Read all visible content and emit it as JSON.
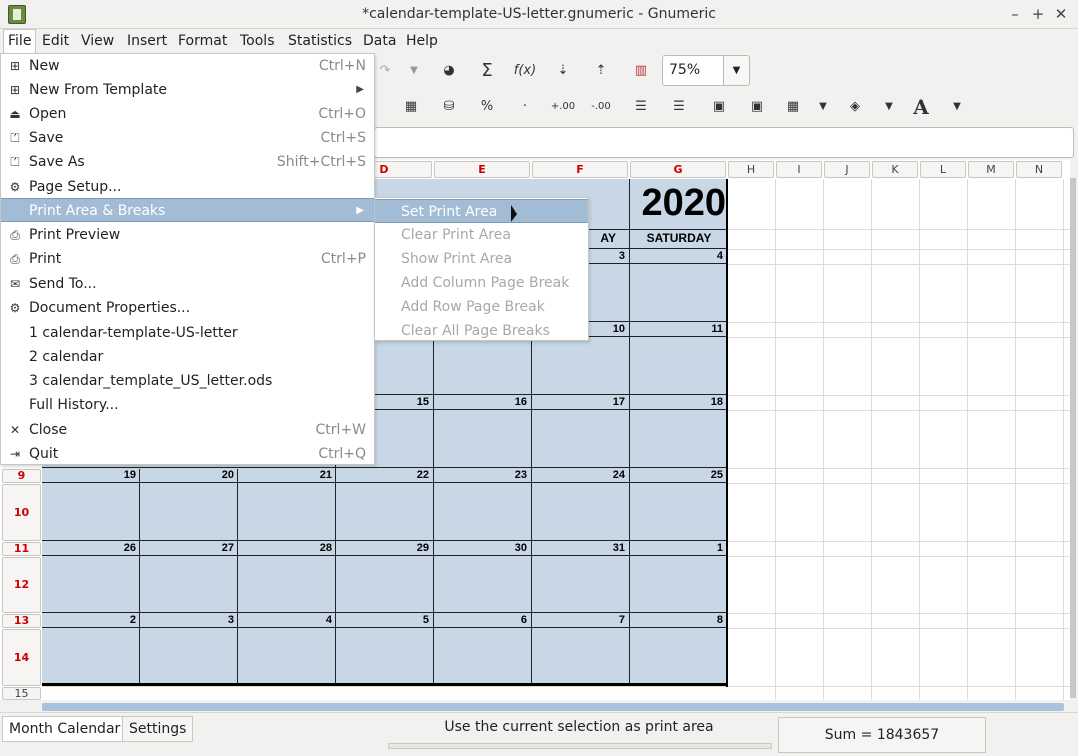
{
  "window": {
    "title": "*calendar-template-US-letter.gnumeric - Gnumeric",
    "minimize": "–",
    "maximize": "+",
    "close": "✕"
  },
  "menubar": [
    "File",
    "Edit",
    "View",
    "Insert",
    "Format",
    "Tools",
    "Statistics",
    "Data",
    "Help"
  ],
  "toolbar": {
    "zoom": "75%"
  },
  "file_menu": [
    {
      "label": "New",
      "accel": "Ctrl+N",
      "icon": "new-file-icon"
    },
    {
      "label": "New From Template",
      "accel": "",
      "icon": "new-template-icon",
      "submenu": true
    },
    {
      "label": "Open",
      "accel": "Ctrl+O",
      "icon": "open-icon"
    },
    {
      "label": "Save",
      "accel": "Ctrl+S",
      "icon": "save-icon"
    },
    {
      "label": "Save As",
      "accel": "Shift+Ctrl+S",
      "icon": "save-as-icon"
    },
    {
      "label": "Page Setup...",
      "accel": "",
      "icon": "page-setup-icon"
    },
    {
      "label": "Print Area & Breaks",
      "accel": "",
      "icon": "",
      "submenu": true
    },
    {
      "label": "Print Preview",
      "accel": "",
      "icon": "print-preview-icon"
    },
    {
      "label": "Print",
      "accel": "Ctrl+P",
      "icon": "print-icon"
    },
    {
      "label": "Send To...",
      "accel": "",
      "icon": "send-icon"
    },
    {
      "label": "Document Properties...",
      "accel": "",
      "icon": "properties-icon"
    },
    {
      "label": "1 calendar-template-US-letter",
      "accel": "",
      "icon": ""
    },
    {
      "label": "2 calendar",
      "accel": "",
      "icon": ""
    },
    {
      "label": "3 calendar_template_US_letter.ods",
      "accel": "",
      "icon": ""
    },
    {
      "label": "Full History...",
      "accel": "",
      "icon": ""
    },
    {
      "label": "Close",
      "accel": "Ctrl+W",
      "icon": "close-icon"
    },
    {
      "label": "Quit",
      "accel": "Ctrl+Q",
      "icon": "quit-icon"
    }
  ],
  "print_area_submenu": [
    {
      "label": "Set Print Area",
      "enabled": true
    },
    {
      "label": "Clear Print Area",
      "enabled": false
    },
    {
      "label": "Show Print Area",
      "enabled": false
    },
    {
      "label": "Add Column Page Break",
      "enabled": false
    },
    {
      "label": "Add Row Page Break",
      "enabled": false
    },
    {
      "label": "Clear All Page Breaks",
      "enabled": false
    }
  ],
  "sheet": {
    "columns": [
      "D",
      "E",
      "F",
      "G",
      "H",
      "I",
      "J",
      "K",
      "L",
      "M",
      "N"
    ],
    "rows": [
      "9",
      "10",
      "11",
      "12",
      "13",
      "14",
      "15"
    ],
    "calendar": {
      "year": "2020",
      "day_headers": [
        "AY",
        "SATURDAY"
      ],
      "week1": [
        "3",
        "4"
      ],
      "week2": [
        "10",
        "11"
      ],
      "week3": [
        "15",
        "16",
        "17",
        "18"
      ],
      "week4": [
        "19",
        "20",
        "21",
        "22",
        "23",
        "24",
        "25"
      ],
      "week5": [
        "26",
        "27",
        "28",
        "29",
        "30",
        "31",
        "1"
      ],
      "week6": [
        "2",
        "3",
        "4",
        "5",
        "6",
        "7",
        "8"
      ]
    }
  },
  "tabs": [
    "Month Calendar",
    "Settings"
  ],
  "status": {
    "message": "Use the current selection as print area",
    "sum": "Sum = 1843657"
  }
}
